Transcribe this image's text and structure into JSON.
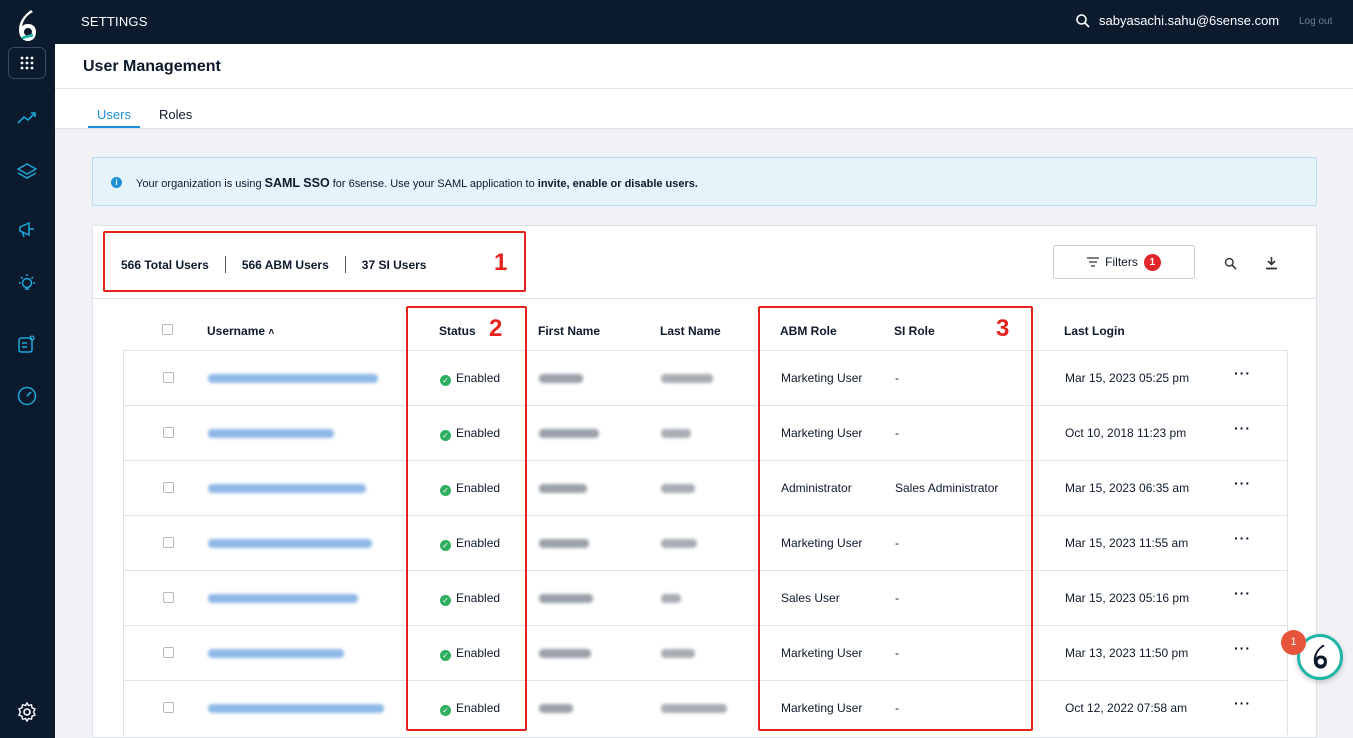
{
  "app": {
    "section_title": "SETTINGS",
    "user_email": "sabyasachi.sahu@6sense.com",
    "logout_label": "Log out",
    "brand_color": "#0c1a2e",
    "accent_color": "#1d8fd6"
  },
  "left_nav": {
    "icons": [
      "logo-icon",
      "apps-grid-icon",
      "trending-icon",
      "layers-icon",
      "megaphone-icon",
      "lightbulb-icon",
      "report-icon",
      "gauge-icon",
      "settings-gear-icon"
    ]
  },
  "page": {
    "title": "User Management",
    "tabs": [
      {
        "label": "Users",
        "active": true
      },
      {
        "label": "Roles",
        "active": false
      }
    ]
  },
  "banner": {
    "prefix": "Your organization is using ",
    "saml_sso": "SAML SSO",
    "middle": " for 6sense. Use your SAML application to ",
    "action": "invite, enable or disable users.",
    "info_symbol": "i"
  },
  "stats": {
    "total": "566 Total Users",
    "abm": "566 ABM Users",
    "si": "37 SI Users"
  },
  "toolbar": {
    "filters_label": "Filters",
    "filters_count": "1"
  },
  "table": {
    "columns": [
      "Username",
      "Status",
      "First Name",
      "Last Name",
      "ABM Role",
      "SI Role",
      "Last Login"
    ],
    "sort_indicator": "˄",
    "rows": [
      {
        "status": "Enabled",
        "abm_role": "Marketing User",
        "si_role": "-",
        "last_login": "Mar 15, 2023 05:25 pm"
      },
      {
        "status": "Enabled",
        "abm_role": "Marketing User",
        "si_role": "-",
        "last_login": "Oct 10, 2018 11:23 pm"
      },
      {
        "status": "Enabled",
        "abm_role": "Administrator",
        "si_role": "Sales Administrator",
        "last_login": "Mar 15, 2023 06:35 am"
      },
      {
        "status": "Enabled",
        "abm_role": "Marketing User",
        "si_role": "-",
        "last_login": "Mar 15, 2023 11:55 am"
      },
      {
        "status": "Enabled",
        "abm_role": "Sales User",
        "si_role": "-",
        "last_login": "Mar 15, 2023 05:16 pm"
      },
      {
        "status": "Enabled",
        "abm_role": "Marketing User",
        "si_role": "-",
        "last_login": "Mar 13, 2023 11:50 pm"
      },
      {
        "status": "Enabled",
        "abm_role": "Marketing User",
        "si_role": "-",
        "last_login": "Oct 12, 2022 07:58 am"
      }
    ],
    "row_menu": "···"
  },
  "annotations": {
    "box1": "1",
    "box2": "2",
    "box3": "3",
    "color": "#e5231c"
  },
  "chat_widget": {
    "badge_count": "1"
  }
}
